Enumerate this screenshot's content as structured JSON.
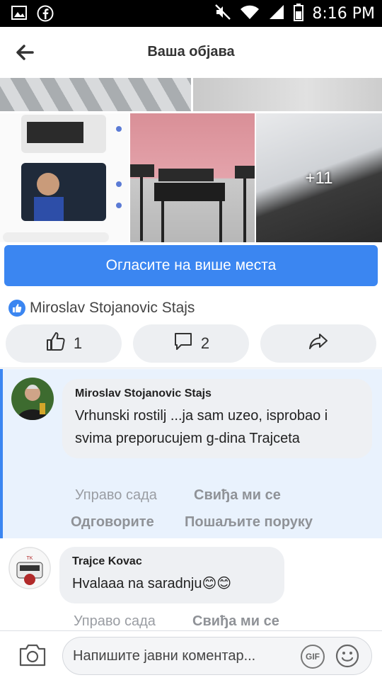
{
  "status_bar": {
    "time": "8:16 PM",
    "left_icons": [
      "gallery-icon",
      "facebook-icon"
    ],
    "right_icons": [
      "mute-icon",
      "wifi-icon",
      "signal-icon",
      "battery-icon"
    ]
  },
  "header": {
    "title": "Ваша објава",
    "back_icon": "back-arrow-icon"
  },
  "photos": {
    "more_count": "+11"
  },
  "promote": {
    "label": "Огласите на више места"
  },
  "reactions": {
    "reactor_name": "Miroslav Stojanovic Stajs",
    "icon": "like-badge-icon"
  },
  "actions": {
    "like_count": "1",
    "comment_count": "2",
    "share_icon": "share-icon"
  },
  "comments": [
    {
      "author": "Miroslav Stojanovic Stajs",
      "text": "Vrhunski rostilj ...ja sam uzeo, isprobao i svima preporucujem g-dina Trajceta",
      "time": "Управо сада",
      "like_label": "Свиђа ми се",
      "reply_label": "Одговорите",
      "message_label": "Пошаљите поруку"
    },
    {
      "author": "Trajce Kovac",
      "text": "Hvalaaa na saradnju😊😊",
      "time": "Управо сада",
      "like_label": "Свиђа ми се"
    }
  ],
  "composer": {
    "placeholder": "Напишите јавни коментар...",
    "gif_label": "GIF",
    "camera_icon": "camera-icon",
    "emoji_icon": "emoji-icon"
  },
  "colors": {
    "accent": "#3b86f1",
    "highlight_bg": "#e9f2fd",
    "bubble_bg": "#eef0f3",
    "button_bg": "#edeff2"
  }
}
